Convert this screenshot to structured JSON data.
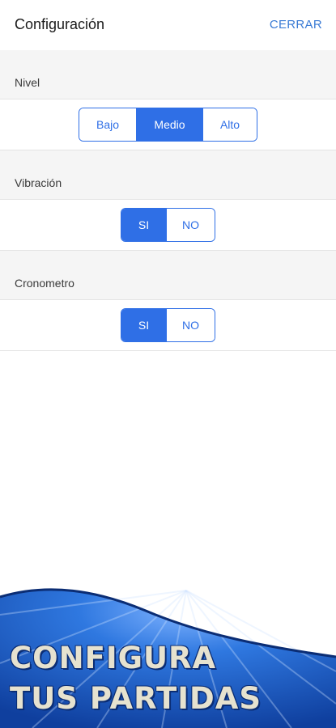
{
  "header": {
    "title": "Configuración",
    "close_label": "CERRAR"
  },
  "settings": {
    "level": {
      "label": "Nivel",
      "options": [
        "Bajo",
        "Medio",
        "Alto"
      ],
      "selected": "Medio"
    },
    "vibration": {
      "label": "Vibración",
      "options": [
        "SI",
        "NO"
      ],
      "selected": "SI"
    },
    "timer": {
      "label": "Cronometro",
      "options": [
        "SI",
        "NO"
      ],
      "selected": "SI"
    }
  },
  "promo": {
    "line1": "CONFIGURA",
    "line2": "TUS PARTIDAS"
  },
  "colors": {
    "accent": "#2f6fe6",
    "header_link": "#3a7bd5",
    "section_bg": "#f5f5f5",
    "banner_blue": "#1e63c8",
    "banner_text": "#e6e2cf"
  }
}
